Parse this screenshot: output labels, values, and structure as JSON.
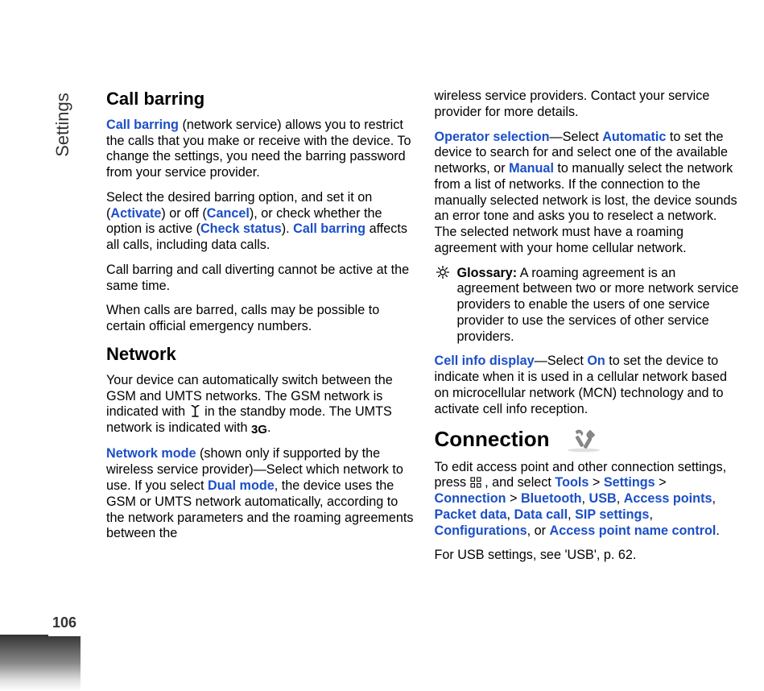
{
  "sidebar": {
    "section_label": "Settings",
    "page_number": "106"
  },
  "left_col": {
    "h_call_barring": "Call barring",
    "p1_a": "Call barring",
    "p1_b": " (network service) allows you to restrict the calls that you make or receive with the device. To change the settings, you need the barring password from your service provider.",
    "p2_a": "Select the desired barring option, and set it on (",
    "p2_b": "Activate",
    "p2_c": ") or off (",
    "p2_d": "Cancel",
    "p2_e": "), or check whether the option is active (",
    "p2_f": "Check status",
    "p2_g": "). ",
    "p2_h": "Call barring",
    "p2_i": " affects all calls, including data calls.",
    "p3": "Call barring and call diverting cannot be active at the same time.",
    "p4": "When calls are barred, calls may be possible to certain official emergency numbers.",
    "h_network": "Network",
    "p5_a": "Your device can automatically switch between the GSM and UMTS networks. The GSM network is indicated with ",
    "p5_b": " in the standby mode. The UMTS network is indicated with ",
    "p5_c": ".",
    "p6_a": "Network mode",
    "p6_b": " (shown only if supported by the wireless service provider)—Select which network to use. If you select ",
    "p6_c": "Dual mode",
    "p6_d": ", the device uses the GSM or UMTS network automatically, according to the network parameters and the roaming agreements between the "
  },
  "right_col": {
    "p1": "wireless service providers. Contact your service provider for more details.",
    "p2_a": "Operator selection",
    "p2_b": "—Select ",
    "p2_c": "Automatic",
    "p2_d": " to set the device to search for and select one of the available networks, or ",
    "p2_e": "Manual",
    "p2_f": " to manually select the network from a list of networks. If the connection to the manually selected network is lost, the device sounds an error tone and asks you to reselect a network. The selected network must have a roaming agreement with your home cellular network.",
    "gloss_label": "Glossary:",
    "gloss_text": " A roaming agreement is an agreement between two or more network service providers to enable the users of one service provider to use the services of other service providers.",
    "p3_a": "Cell info display",
    "p3_b": "—Select ",
    "p3_c": "On",
    "p3_d": " to set the device to indicate when it is used in a cellular network based on microcellular network (MCN) technology and to activate cell info reception.",
    "h_connection": "Connection",
    "p4_a": "To edit access point and other connection settings, press ",
    "p4_b": " , and select ",
    "p4_c": "Tools",
    "p4_d": " > ",
    "p4_e": "Settings",
    "p4_f": " > ",
    "p4_g": "Connection",
    "p4_h": " > ",
    "p4_i": "Bluetooth",
    "p4_j": ", ",
    "p4_k": "USB",
    "p4_l": ", ",
    "p4_m": "Access points",
    "p4_n": ", ",
    "p4_o": "Packet data",
    "p4_p": ", ",
    "p4_q": "Data call",
    "p4_r": ", ",
    "p4_s": "SIP settings",
    "p4_t": ", ",
    "p4_u": "Configurations",
    "p4_v": ", or ",
    "p4_w": "Access point name control",
    "p4_x": ".",
    "p5": "For USB settings, see 'USB', p. 62."
  }
}
